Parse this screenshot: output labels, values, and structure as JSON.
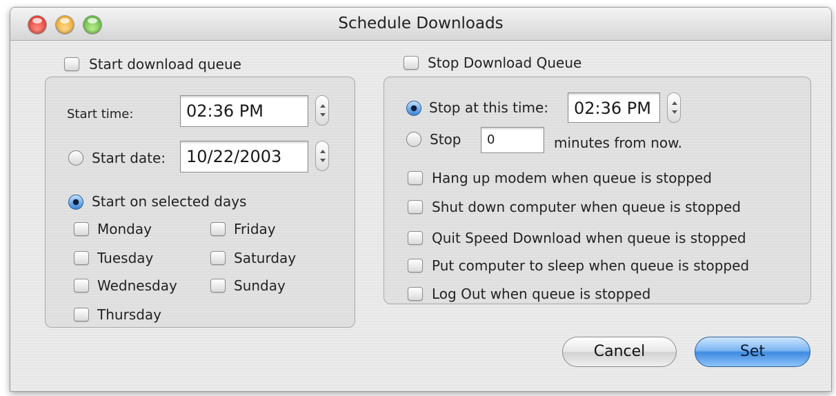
{
  "window": {
    "title": "Schedule Downloads"
  },
  "start": {
    "checkbox_label": "Start download queue",
    "start_time_label": "Start time:",
    "start_time_value": "02:36 PM",
    "start_date_label": "Start date:",
    "start_date_value": "10/22/2003",
    "selected_days_label": "Start on selected days",
    "days": {
      "monday": "Monday",
      "tuesday": "Tuesday",
      "wednesday": "Wednesday",
      "thursday": "Thursday",
      "friday": "Friday",
      "saturday": "Saturday",
      "sunday": "Sunday"
    }
  },
  "stop": {
    "checkbox_label": "Stop Download Queue",
    "stop_at_time_label": "Stop at this time:",
    "stop_time_value": "02:36 PM",
    "stop_label": "Stop",
    "minutes_value": "0",
    "minutes_suffix": "minutes from now.",
    "options": {
      "hang_up": "Hang up modem when queue is stopped",
      "shut_down": "Shut down computer when queue is stopped",
      "quit": "Quit Speed Download when queue is stopped",
      "sleep": "Put computer to sleep when queue is stopped",
      "log_out": "Log Out when queue is stopped"
    }
  },
  "buttons": {
    "cancel": "Cancel",
    "set": "Set"
  },
  "colors": {
    "default_button": "#5aa3ec",
    "radio_selected": "#3a83d4"
  }
}
